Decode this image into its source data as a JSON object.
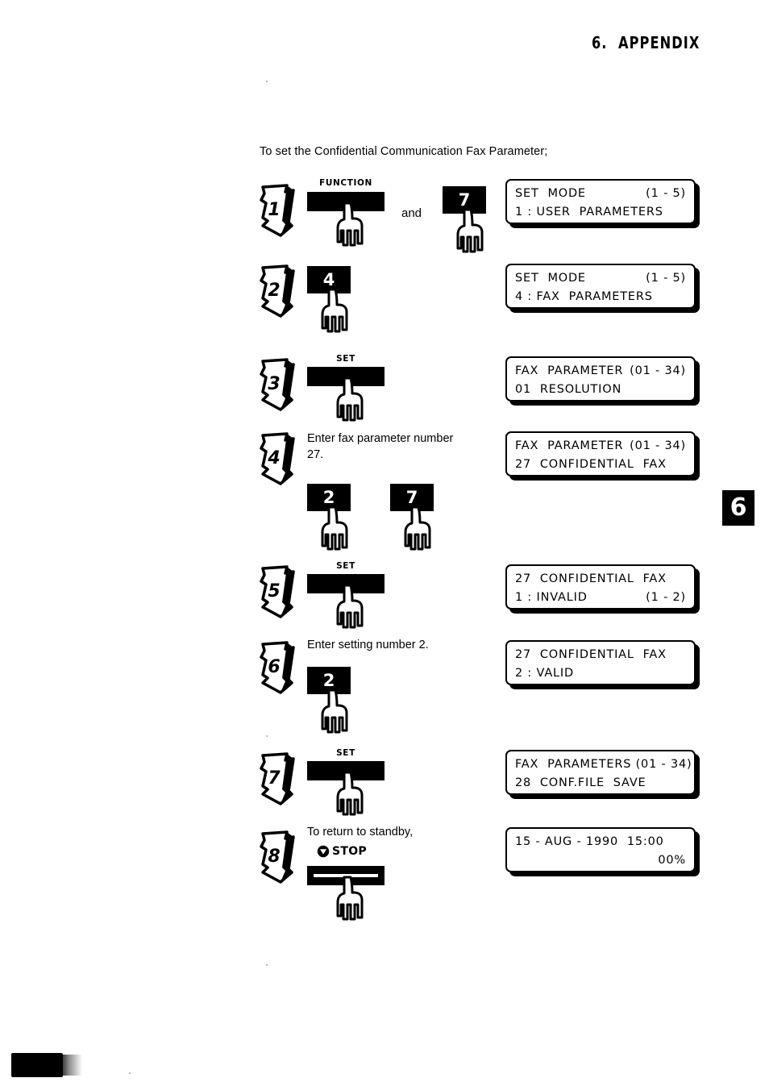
{
  "page": {
    "header": "6.  APPENDIX",
    "chapter_tab": "6",
    "intro": "To set the Confidential Communication Fax Parameter;"
  },
  "steps": [
    {
      "number": "1",
      "instruction": "",
      "keys": [
        {
          "type": "wide",
          "name": "FUNCTION",
          "label": ""
        },
        {
          "type": "num",
          "name": "",
          "label": "7"
        }
      ],
      "connector": "and",
      "display": {
        "line1_left": "SET  MODE",
        "line1_right": "(1 - 5)",
        "line2_left": "1 : USER  PARAMETERS",
        "line2_right": ""
      }
    },
    {
      "number": "2",
      "instruction": "",
      "keys": [
        {
          "type": "num",
          "name": "",
          "label": "4"
        }
      ],
      "connector": "",
      "display": {
        "line1_left": "SET  MODE",
        "line1_right": "(1 - 5)",
        "line2_left": "4 : FAX  PARAMETERS",
        "line2_right": ""
      }
    },
    {
      "number": "3",
      "instruction": "",
      "keys": [
        {
          "type": "wide",
          "name": "SET",
          "label": ""
        }
      ],
      "connector": "",
      "display": {
        "line1_left": "FAX  PARAMETER",
        "line1_right": "(01 - 34)",
        "line2_left": "01  RESOLUTION",
        "line2_right": ""
      }
    },
    {
      "number": "4",
      "instruction": "Enter fax parameter number\n27.",
      "keys": [
        {
          "type": "num",
          "name": "",
          "label": "2"
        },
        {
          "type": "num",
          "name": "",
          "label": "7"
        }
      ],
      "connector": "",
      "display": {
        "line1_left": "FAX  PARAMETER",
        "line1_right": "(01 - 34)",
        "line2_left": "27  CONFIDENTIAL  FAX",
        "line2_right": ""
      }
    },
    {
      "number": "5",
      "instruction": "",
      "keys": [
        {
          "type": "wide",
          "name": "SET",
          "label": ""
        }
      ],
      "connector": "",
      "display": {
        "line1_left": "27  CONFIDENTIAL  FAX",
        "line1_right": "",
        "line2_left": "1 : INVALID",
        "line2_right": "(1 - 2)"
      }
    },
    {
      "number": "6",
      "instruction": "Enter setting number 2.",
      "keys": [
        {
          "type": "num",
          "name": "",
          "label": "2"
        }
      ],
      "connector": "",
      "display": {
        "line1_left": "27  CONFIDENTIAL  FAX",
        "line1_right": "",
        "line2_left": "2 : VALID",
        "line2_right": ""
      }
    },
    {
      "number": "7",
      "instruction": "",
      "keys": [
        {
          "type": "wide",
          "name": "SET",
          "label": ""
        }
      ],
      "connector": "",
      "display": {
        "line1_left": "FAX  PARAMETERS (01 - 34)",
        "line1_right": "",
        "line2_left": "28  CONF.FILE  SAVE",
        "line2_right": ""
      }
    },
    {
      "number": "8",
      "instruction": "To return to standby,",
      "stop_label": "STOP",
      "keys": [
        {
          "type": "stopbar",
          "name": "",
          "label": ""
        }
      ],
      "connector": "",
      "display": {
        "line1_left": "15 - AUG - 1990  15:00",
        "line1_right": "",
        "line2_left": "",
        "line2_right": "00%"
      }
    }
  ]
}
